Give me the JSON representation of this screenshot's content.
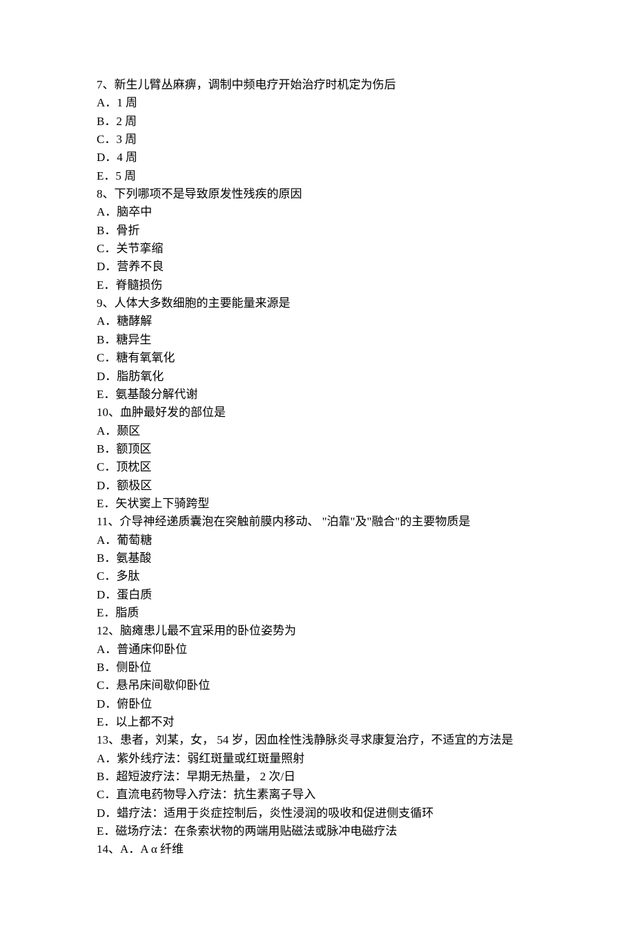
{
  "questions": [
    {
      "number": "7",
      "stem": "、新生儿臂丛麻痹，调制中频电疗开始治疗时机定为伤后",
      "options": [
        "A．1 周",
        "B．2 周",
        "C．3 周",
        "D．4 周",
        "E．5 周"
      ]
    },
    {
      "number": "8",
      "stem": "、下列哪项不是导致原发性残疾的原因",
      "options": [
        "A．脑卒中",
        "B．骨折",
        "C．关节挛缩",
        "D．营养不良",
        "E．脊髓损伤"
      ]
    },
    {
      "number": "9",
      "stem": "、人体大多数细胞的主要能量来源是",
      "options": [
        "A．糖酵解",
        "B．糖异生",
        "C．糖有氧氧化",
        "D．脂肪氧化",
        "E．氨基酸分解代谢"
      ]
    },
    {
      "number": "10",
      "stem": "、血肿最好发的部位是",
      "options": [
        "A．颞区",
        "B．额顶区",
        "C．顶枕区",
        "D．额极区",
        "E．矢状窦上下骑跨型"
      ]
    },
    {
      "number": "11",
      "stem": "、介导神经递质囊泡在突触前膜内移动、 \"泊靠\"及\"融合\"的主要物质是",
      "options": [
        "A．葡萄糖",
        "B．氨基酸",
        "C．多肽",
        "D．蛋白质",
        "E．脂质"
      ]
    },
    {
      "number": "12",
      "stem": "、脑瘫患儿最不宜采用的卧位姿势为",
      "options": [
        "A．普通床仰卧位",
        "B．侧卧位",
        "C．悬吊床间歇仰卧位",
        "D．俯卧位",
        "E．以上都不对"
      ]
    },
    {
      "number": "13",
      "stem": "、患者，刘某，女，  54 岁，因血栓性浅静脉炎寻求康复治疗，不适宜的方法是",
      "options": [
        "A．紫外线疗法：弱红斑量或红斑量照射",
        "B．超短波疗法：早期无热量，  2 次/日",
        "C．直流电药物导入疗法：抗生素离子导入",
        "D．蜡疗法：适用于炎症控制后，炎性浸润的吸收和促进侧支循环",
        "E．磁场疗法：在条索状物的两端用贴磁法或脉冲电磁疗法"
      ]
    },
    {
      "number": "14",
      "stem": "、A．A α 纤维",
      "options": []
    }
  ]
}
